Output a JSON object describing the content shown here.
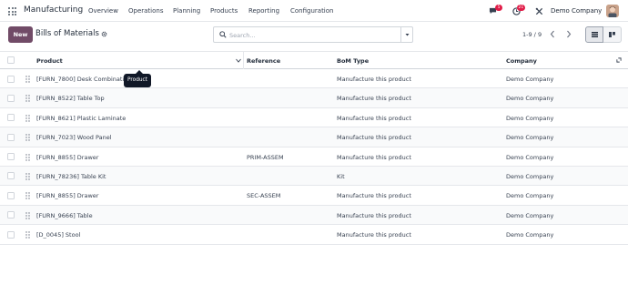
{
  "navbar": {
    "app_name": "Manufacturing",
    "menu": [
      "Overview",
      "Operations",
      "Planning",
      "Products",
      "Reporting",
      "Configuration"
    ],
    "chat_badge": "5",
    "activity_badge": "21",
    "company": "Demo Company",
    "icons": {
      "apps": "apps-grid-icon",
      "chat": "chat-icon",
      "activity": "clock-icon",
      "tools": "tools-icon"
    }
  },
  "control_panel": {
    "new_label": "New",
    "title": "Bills of Materials",
    "search_placeholder": "Search...",
    "pager": "1-9 / 9"
  },
  "table": {
    "columns": [
      "Product",
      "Reference",
      "BoM Type",
      "Company"
    ],
    "rows": [
      {
        "product": "[FURN_7800] Desk Combination",
        "reference": "",
        "bom_type": "Manufacture this product",
        "company": "Demo Company"
      },
      {
        "product": "[FURN_8522] Table Top",
        "reference": "",
        "bom_type": "Manufacture this product",
        "company": "Demo Company"
      },
      {
        "product": "[FURN_8621] Plastic Laminate",
        "reference": "",
        "bom_type": "Manufacture this product",
        "company": "Demo Company"
      },
      {
        "product": "[FURN_7023] Wood Panel",
        "reference": "",
        "bom_type": "Manufacture this product",
        "company": "Demo Company"
      },
      {
        "product": "[FURN_8855] Drawer",
        "reference": "PRIM-ASSEM",
        "bom_type": "Manufacture this product",
        "company": "Demo Company"
      },
      {
        "product": "[FURN_78236] Table Kit",
        "reference": "",
        "bom_type": "Kit",
        "company": "Demo Company"
      },
      {
        "product": "[FURN_8855] Drawer",
        "reference": "SEC-ASSEM",
        "bom_type": "Manufacture this product",
        "company": "Demo Company"
      },
      {
        "product": "[FURN_9666] Table",
        "reference": "",
        "bom_type": "Manufacture this product",
        "company": "Demo Company"
      },
      {
        "product": "[D_0045] Stool",
        "reference": "",
        "bom_type": "Manufacture this product",
        "company": "Demo Company"
      }
    ]
  },
  "tooltip": {
    "text": "Product"
  },
  "colors": {
    "brand": "#714b67",
    "badge": "#e11d48"
  }
}
